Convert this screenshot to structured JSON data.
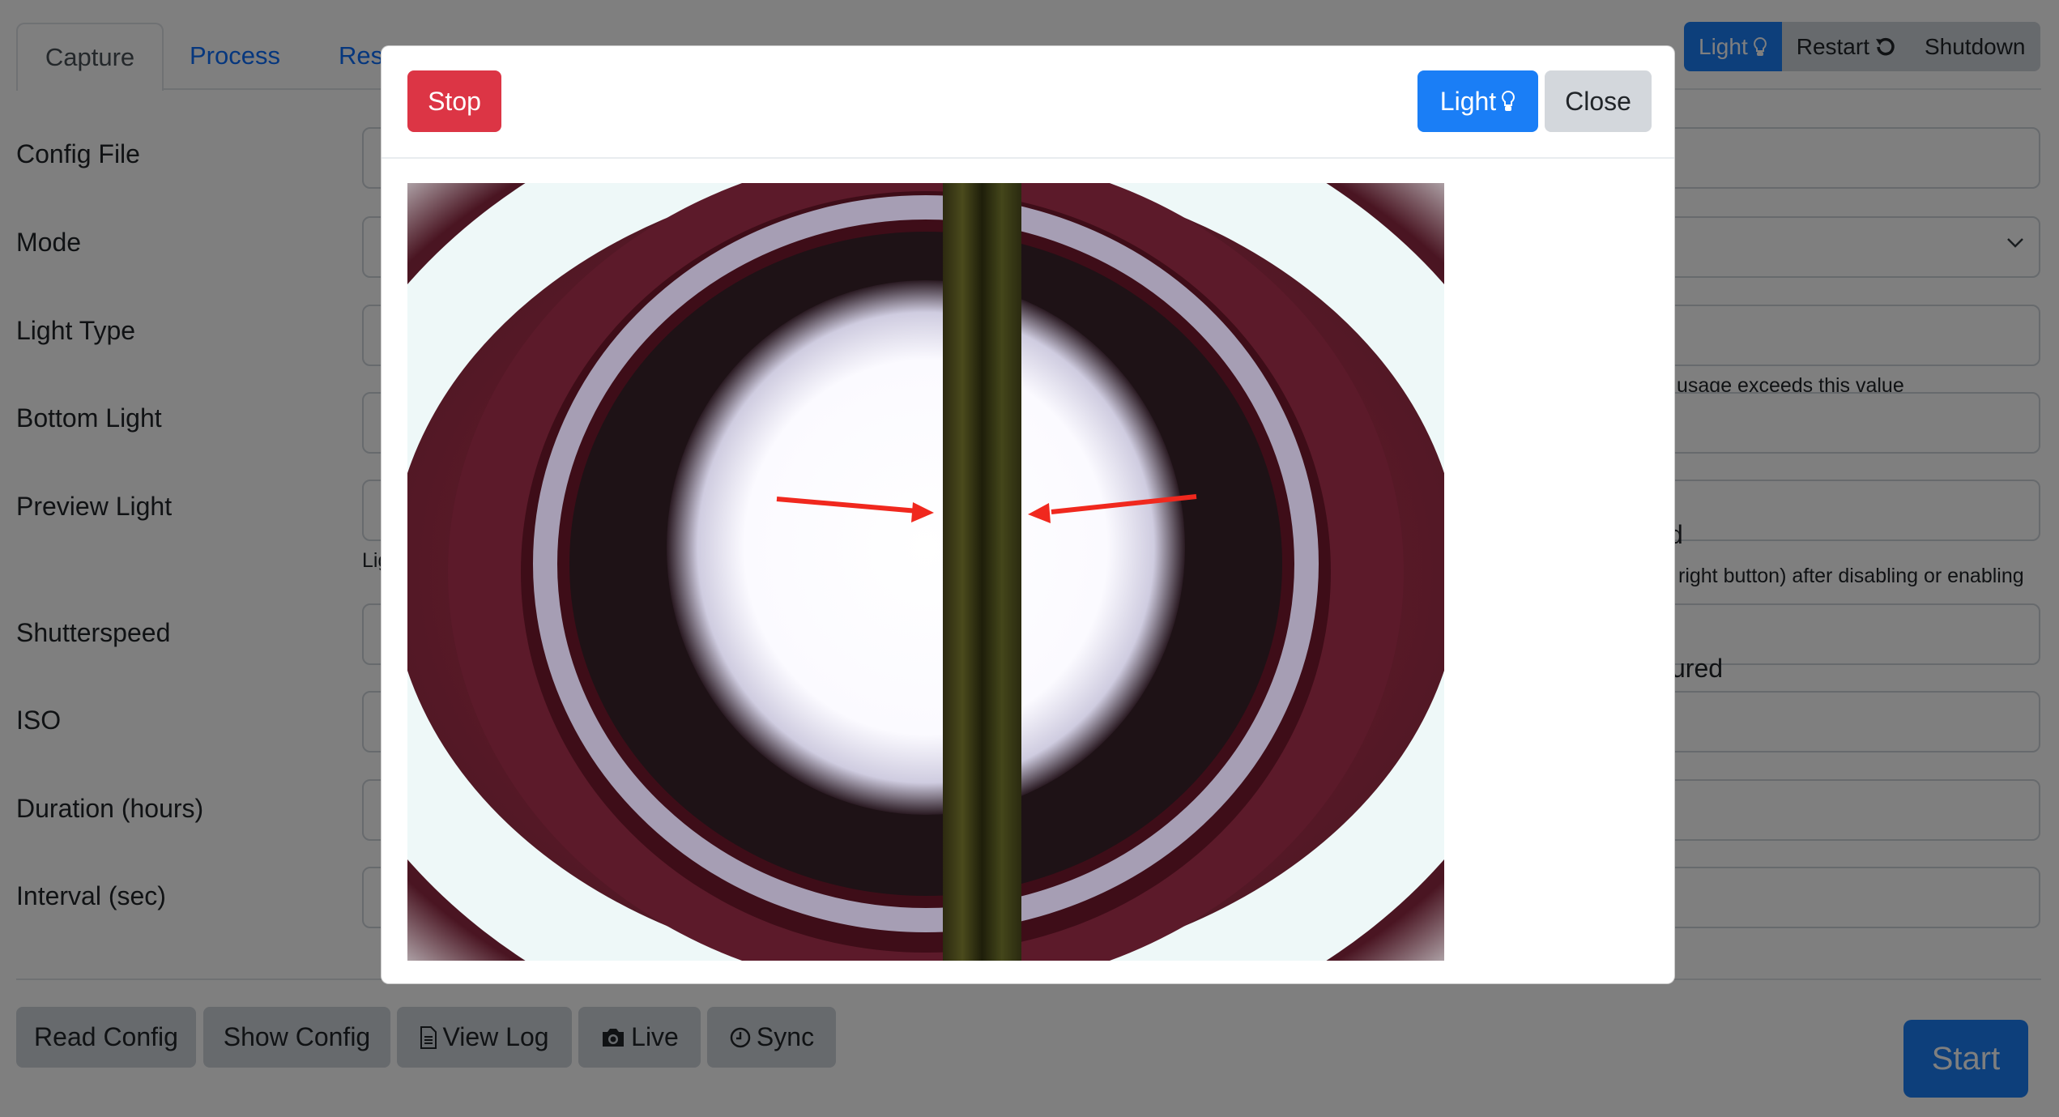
{
  "tabs": [
    {
      "label": "Capture",
      "active": true
    },
    {
      "label": "Process"
    },
    {
      "label": "Res"
    }
  ],
  "top_actions": {
    "light": {
      "label": "Light",
      "icon": "lightbulb-icon"
    },
    "restart": {
      "label": "Restart",
      "icon": "restart-icon"
    },
    "shutdown": {
      "label": "Shutdown"
    }
  },
  "form": {
    "labels": {
      "config_file": "Config File",
      "mode": "Mode",
      "light_type": "Light Type",
      "bottom_light": "Bottom Light",
      "preview_light": "Preview Light",
      "shutterspeed": "Shutterspeed",
      "iso": "ISO",
      "duration": "Duration (hours)",
      "interval": "Interval (sec)"
    },
    "preview_light_help": "Lig",
    "right_column": {
      "help_usage": "usage exceeds this value",
      "text_d": "d",
      "help_restart": "right button) after disabling or enabling",
      "text_ured": "ured"
    }
  },
  "bottom_actions": {
    "read_config": "Read Config",
    "show_config": "Show Config",
    "view_log": "View Log",
    "live": "Live",
    "sync": "Sync",
    "start": "Start"
  },
  "modal": {
    "stop_label": "Stop",
    "light_label": "Light",
    "close_label": "Close",
    "image_alt": "Live camera preview showing a plant stem in a circular holder with red arrows pointing at the stem edges",
    "annotation_color": "#f0281e"
  },
  "colors": {
    "primary": "#1a7ef6",
    "danger": "#dc3545",
    "secondary": "#d3d7dc"
  }
}
